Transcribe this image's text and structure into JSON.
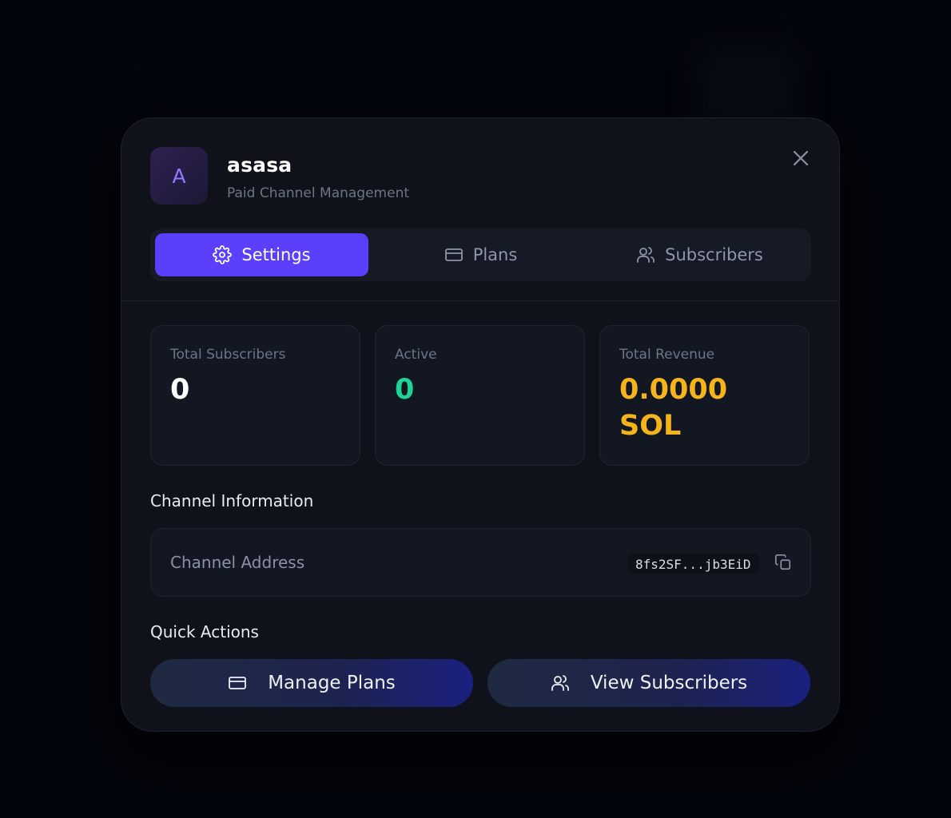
{
  "header": {
    "avatar_letter": "A",
    "title": "asasa",
    "subtitle": "Paid Channel Management"
  },
  "tabs": [
    {
      "label": "Settings",
      "icon": "gear-icon",
      "active": true
    },
    {
      "label": "Plans",
      "icon": "card-icon",
      "active": false
    },
    {
      "label": "Subscribers",
      "icon": "users-icon",
      "active": false
    }
  ],
  "stats": {
    "total_subscribers": {
      "label": "Total Subscribers",
      "value": "0"
    },
    "active": {
      "label": "Active",
      "value": "0"
    },
    "revenue": {
      "label": "Total Revenue",
      "value_line1": "0.0000",
      "value_line2": "SOL"
    }
  },
  "channel_info": {
    "title": "Channel Information",
    "address_label": "Channel Address",
    "address_value": "8fs2SF...jb3EiD"
  },
  "quick_actions": {
    "title": "Quick Actions",
    "manage_plans": "Manage Plans",
    "view_subscribers": "View Subscribers"
  },
  "colors": {
    "accent": "#5a3ffd",
    "active_green": "#1ed396",
    "revenue_gold": "#f6b41b",
    "avatar_letter": "#8b7bff"
  }
}
